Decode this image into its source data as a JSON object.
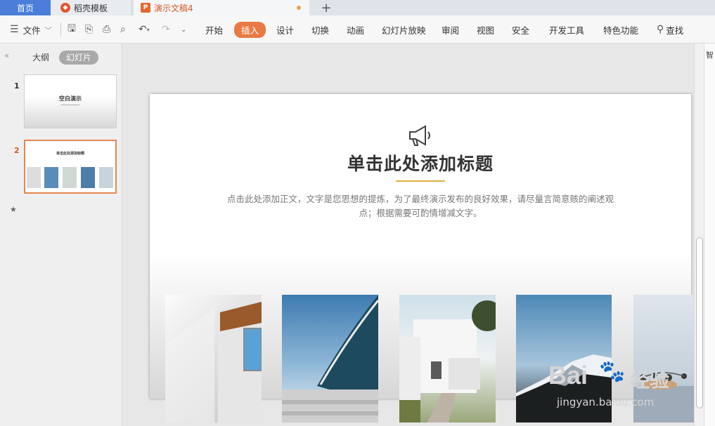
{
  "tabs": {
    "home": "首页",
    "template": "稻壳模板",
    "document": "演示文稿4",
    "new_tab_icon": "plus-icon"
  },
  "toolbar": {
    "file_menu": "文件",
    "menus": [
      "开始",
      "插入",
      "设计",
      "切换",
      "动画",
      "幻灯片放映",
      "审阅",
      "视图",
      "安全",
      "开发工具",
      "特色功能"
    ],
    "active_menu": "插入",
    "search": "查找",
    "accent_color": "#e97a45"
  },
  "left_panel": {
    "outline_tab": "大纲",
    "slides_tab": "幻灯片",
    "thumbnails": [
      {
        "number": "1",
        "title": "空白演示"
      },
      {
        "number": "2",
        "title": "单击此处添加标题"
      }
    ]
  },
  "slide": {
    "title": "单击此处添加标题",
    "body": "点击此处添加正文，文字是您思想的提炼，为了最终演示发布的良好效果，请尽量言简意赅的阐述观点；根据需要可酌情增减文字。"
  },
  "right_side": {
    "label": "智"
  },
  "watermark": {
    "brand": "Bai",
    "cn": "经验",
    "url": "jingyan.baidu.com"
  }
}
